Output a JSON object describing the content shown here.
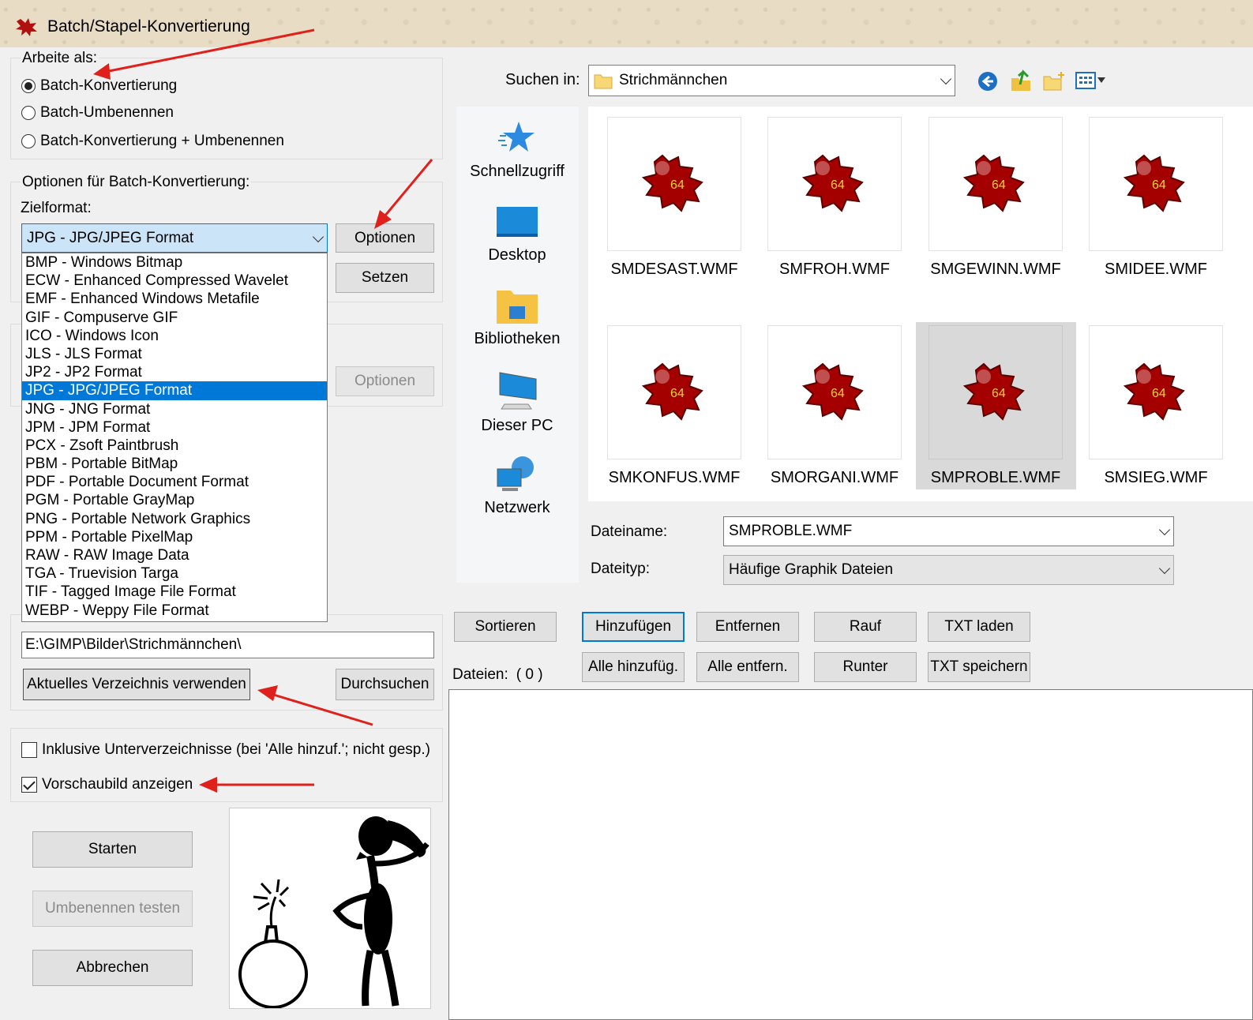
{
  "window": {
    "title": "Batch/Stapel-Konvertierung"
  },
  "mode": {
    "label": "Arbeite als:",
    "options": [
      {
        "label": "Batch-Konvertierung",
        "selected": true
      },
      {
        "label": "Batch-Umbenennen",
        "selected": false
      },
      {
        "label": "Batch-Konvertierung + Umbenennen",
        "selected": false
      }
    ]
  },
  "conversion": {
    "label": "Optionen für Batch-Konvertierung:",
    "target_label": "Zielformat:",
    "target_value": "JPG - JPG/JPEG Format",
    "options_button": "Optionen",
    "set_button": "Setzen",
    "formats": [
      "BMP - Windows Bitmap",
      "ECW - Enhanced Compressed Wavelet",
      "EMF - Enhanced Windows Metafile",
      "GIF - Compuserve GIF",
      "ICO - Windows Icon",
      "JLS - JLS Format",
      "JP2 - JP2 Format",
      "JPG - JPG/JPEG Format",
      "JNG - JNG Format",
      "JPM - JPM Format",
      "PCX - Zsoft Paintbrush",
      "PBM - Portable BitMap",
      "PDF - Portable Document Format",
      "PGM - Portable GrayMap",
      "PNG - Portable Network Graphics",
      "PPM - Portable PixelMap",
      "RAW - RAW Image Data",
      "TGA - Truevision Targa",
      "TIF - Tagged Image File Format",
      "WEBP - Weppy File Format"
    ],
    "highlighted_index": 7
  },
  "rename": {
    "options_button": "Optionen"
  },
  "output": {
    "path": "E:\\GIMP\\Bilder\\Strichmännchen\\",
    "use_current_button": "Aktuelles Verzeichnis verwenden",
    "browse_button": "Durchsuchen"
  },
  "checks": {
    "subdirs": {
      "label": "Inklusive Unterverzeichnisse (bei 'Alle hinzuf.'; nicht gesp.)",
      "checked": false
    },
    "preview": {
      "label": "Vorschaubild anzeigen",
      "checked": true
    }
  },
  "actions": {
    "start": "Starten",
    "test_rename": "Umbenennen testen",
    "cancel": "Abbrechen"
  },
  "browser": {
    "look_in_label": "Suchen in:",
    "look_in_value": "Strichmännchen",
    "places": [
      "Schnellzugriff",
      "Desktop",
      "Bibliotheken",
      "Dieser PC",
      "Netzwerk"
    ],
    "files": [
      {
        "name": "SMDESAST.WMF",
        "badge": "64"
      },
      {
        "name": "SMFROH.WMF",
        "badge": "64"
      },
      {
        "name": "SMGEWINN.WMF",
        "badge": "64"
      },
      {
        "name": "SMIDEE.WMF",
        "badge": "64"
      },
      {
        "name": "SMKONFUS.WMF",
        "badge": "64"
      },
      {
        "name": "SMORGANI.WMF",
        "badge": "64"
      },
      {
        "name": "SMPROBLE.WMF",
        "badge": "64"
      },
      {
        "name": "SMSIEG.WMF",
        "badge": "64"
      }
    ],
    "selected_index": 6,
    "filename_label": "Dateiname:",
    "filename_value": "SMPROBLE.WMF",
    "filetype_label": "Dateityp:",
    "filetype_value": "Häufige Graphik Dateien"
  },
  "list_buttons": {
    "sort": "Sortieren",
    "add": "Hinzufügen",
    "remove": "Entfernen",
    "up": "Rauf",
    "load_txt": "TXT laden",
    "add_all": "Alle hinzufüg.",
    "remove_all": "Alle entfern.",
    "down": "Runter",
    "save_txt": "TXT speichern"
  },
  "files_count": {
    "label": "Dateien:",
    "value": "( 0 )"
  },
  "colors": {
    "accent": "#0078d7",
    "annotation_arrow": "#e0201a",
    "icon_red": "#a40000"
  }
}
